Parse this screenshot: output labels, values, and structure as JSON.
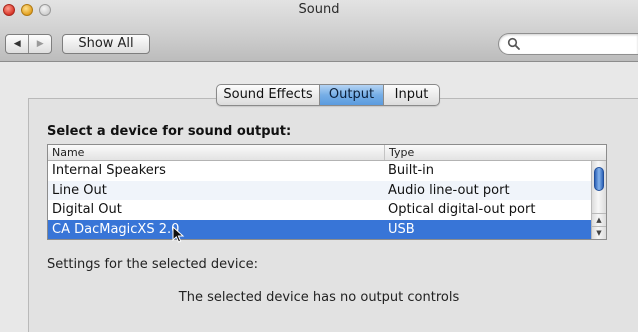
{
  "window": {
    "title": "Sound"
  },
  "toolbar": {
    "back_glyph": "◀",
    "forward_glyph": "▶",
    "show_all_label": "Show All",
    "search_placeholder": ""
  },
  "tabs": [
    {
      "label": "Sound Effects",
      "selected": false
    },
    {
      "label": "Output",
      "selected": true
    },
    {
      "label": "Input",
      "selected": false
    }
  ],
  "output": {
    "select_label": "Select a device for sound output:",
    "columns": [
      "Name",
      "Type"
    ],
    "devices": [
      {
        "name": "Internal Speakers",
        "type": "Built-in"
      },
      {
        "name": "Line Out",
        "type": "Audio line-out port"
      },
      {
        "name": "Digital Out",
        "type": "Optical digital-out port"
      },
      {
        "name": "CA DacMagicXS 2.0",
        "type": "USB",
        "selected": true
      }
    ],
    "settings_label": "Settings for the selected device:",
    "no_controls_message": "The selected device has no output controls"
  },
  "colors": {
    "selection": "#3875d7",
    "tab_selected": "#76aee6"
  },
  "icons": [
    "close-icon",
    "minimize-icon",
    "zoom-icon",
    "search-icon",
    "scroll-up-icon",
    "scroll-down-icon",
    "mouse-pointer-icon"
  ]
}
